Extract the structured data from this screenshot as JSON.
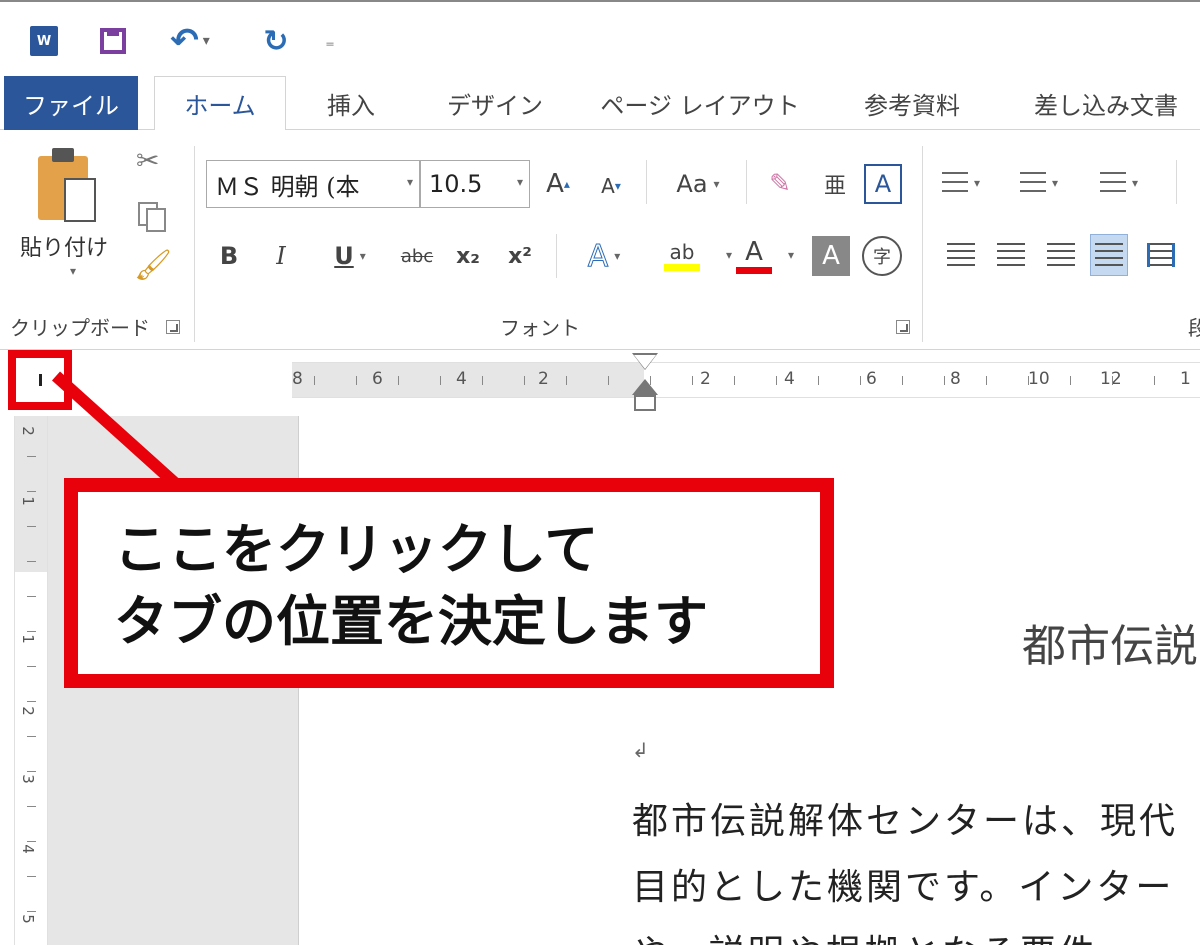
{
  "quick_access": {
    "app_icon_label": "W",
    "undo_label": "↶",
    "redo_label": "↻"
  },
  "tabs": [
    {
      "label": "ファイル"
    },
    {
      "label": "ホーム"
    },
    {
      "label": "挿入"
    },
    {
      "label": "デザイン"
    },
    {
      "label": "ページ レイアウト"
    },
    {
      "label": "参考資料"
    },
    {
      "label": "差し込み文書"
    }
  ],
  "ribbon": {
    "clipboard": {
      "paste_label": "貼り付け",
      "group_label": "クリップボード"
    },
    "font": {
      "font_name": "ＭＳ 明朝 (本",
      "font_size": "10.5",
      "group_label": "フォント",
      "grow_label": "A",
      "shrink_label": "A",
      "case_label": "Aa",
      "bold_label": "B",
      "italic_label": "I",
      "underline_label": "U",
      "strike_label": "abc",
      "sub_label": "x₂",
      "sup_label": "x²",
      "effects_label": "A",
      "highlight_label": "ab",
      "color_label": "A",
      "shade_label": "A",
      "enclose_label": "字",
      "phonetic_label": "亜",
      "border_label": "A",
      "highlight_color": "#ffff00",
      "font_color": "#e8000b"
    },
    "paragraph": {
      "group_label_partial": "段"
    }
  },
  "ruler": {
    "tab_selector_symbol": "L",
    "left_numbers": [
      "8",
      "6",
      "4",
      "2"
    ],
    "right_numbers": [
      "2",
      "4",
      "6",
      "8",
      "10",
      "12",
      "1"
    ],
    "vertical_numbers": [
      "2",
      "1",
      "1",
      "2",
      "3",
      "4",
      "5"
    ]
  },
  "document": {
    "title_partial": "都市伝説",
    "paragraph_mark": "↲",
    "lines": [
      "都市伝説解体センターは、現代",
      "目的とした機関です。インター",
      "や、説明や根拠となる要件"
    ]
  },
  "callout": {
    "line1": "ここをクリックして",
    "line2": "タブの位置を決定します",
    "border_color": "#e8000b"
  }
}
